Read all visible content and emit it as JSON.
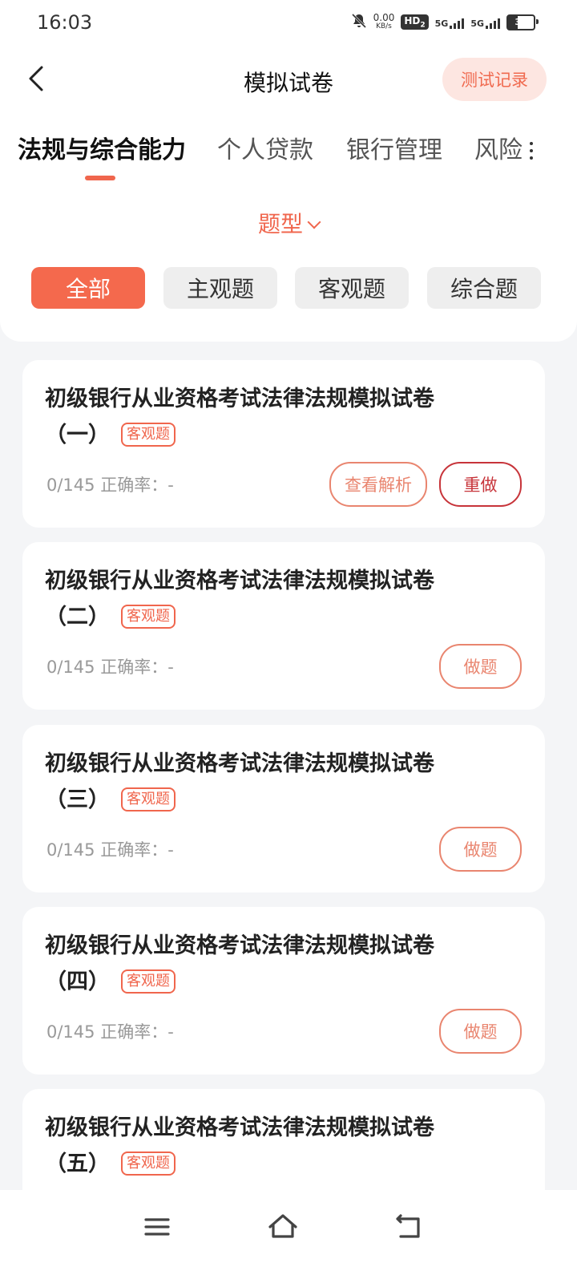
{
  "status_bar": {
    "time": "16:03",
    "net_speed_value": "0.00",
    "net_speed_unit": "KB/s",
    "hd": "HD",
    "hd_sub": "2",
    "sig1": "5G",
    "sig2": "5G",
    "battery": "39"
  },
  "header": {
    "title": "模拟试卷",
    "record_label": "测试记录"
  },
  "tabs": [
    {
      "label": "法规与综合能力",
      "active": true
    },
    {
      "label": "个人贷款"
    },
    {
      "label": "银行管理"
    },
    {
      "label": "风险"
    }
  ],
  "type_selector": {
    "label": "题型"
  },
  "filters": [
    {
      "label": "全部",
      "active": true
    },
    {
      "label": "主观题"
    },
    {
      "label": "客观题"
    },
    {
      "label": "综合题"
    }
  ],
  "papers": [
    {
      "title": "初级银行从业资格考试法律法规模拟试卷",
      "suffix": "（一）",
      "tag": "客观题",
      "progress": "0/145",
      "accuracy_label": "正确率：-",
      "view_label": "查看解析",
      "action_label": "重做"
    },
    {
      "title": "初级银行从业资格考试法律法规模拟试卷",
      "suffix": "（二）",
      "tag": "客观题",
      "progress": "0/145",
      "accuracy_label": "正确率：-",
      "action_label": "做题"
    },
    {
      "title": "初级银行从业资格考试法律法规模拟试卷",
      "suffix": "（三）",
      "tag": "客观题",
      "progress": "0/145",
      "accuracy_label": "正确率：-",
      "action_label": "做题"
    },
    {
      "title": "初级银行从业资格考试法律法规模拟试卷",
      "suffix": "（四）",
      "tag": "客观题",
      "progress": "0/145",
      "accuracy_label": "正确率：-",
      "action_label": "做题"
    },
    {
      "title": "初级银行从业资格考试法律法规模拟试卷",
      "suffix": "（五）",
      "tag": "客观题"
    }
  ],
  "colors": {
    "accent": "#f0664d",
    "redo": "#c7343a",
    "chip_bg": "#eeeeee"
  },
  "icons": {
    "back": "chevron-left-icon",
    "more": "vertical-dots-icon",
    "menu": "menu-icon",
    "home": "home-icon",
    "return": "back-return-icon"
  }
}
